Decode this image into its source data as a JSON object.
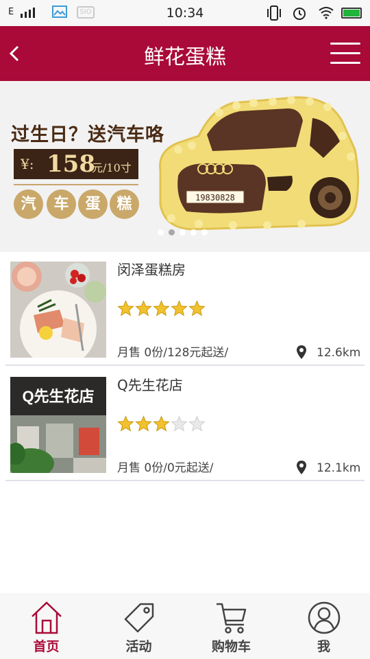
{
  "status_bar": {
    "network": "E",
    "time": "10:34",
    "sio_label": "SIO"
  },
  "header": {
    "title": "鲜花蛋糕",
    "back_icon": "back-chevron-icon",
    "menu_icon": "hamburger-menu-icon"
  },
  "banner": {
    "headline": "过生日？送汽车咯",
    "price_symbol": "¥:",
    "price": "158",
    "price_unit": "元/10寸",
    "chips": [
      "汽",
      "车",
      "蛋",
      "糕"
    ],
    "plate": "19830828",
    "slide_count": 5,
    "active_slide": 1
  },
  "shops": [
    {
      "name": "闵泽蛋糕房",
      "rating": 5,
      "sales": "月售 0份/128元起送/",
      "distance": "12.6km"
    },
    {
      "name": "Q先生花店",
      "rating": 3,
      "sales": "月售 0份/0元起送/",
      "distance": "12.1km",
      "sign_text": "Q先生花店"
    }
  ],
  "tabbar": {
    "items": [
      {
        "label": "首页",
        "icon": "home-icon",
        "active": true
      },
      {
        "label": "活动",
        "icon": "tag-icon",
        "active": false
      },
      {
        "label": "购物车",
        "icon": "cart-icon",
        "active": false
      },
      {
        "label": "我",
        "icon": "user-icon",
        "active": false
      }
    ]
  },
  "colors": {
    "brand": "#a90a38",
    "star_on": "#f2c12e",
    "star_off": "#e3e3e3"
  }
}
